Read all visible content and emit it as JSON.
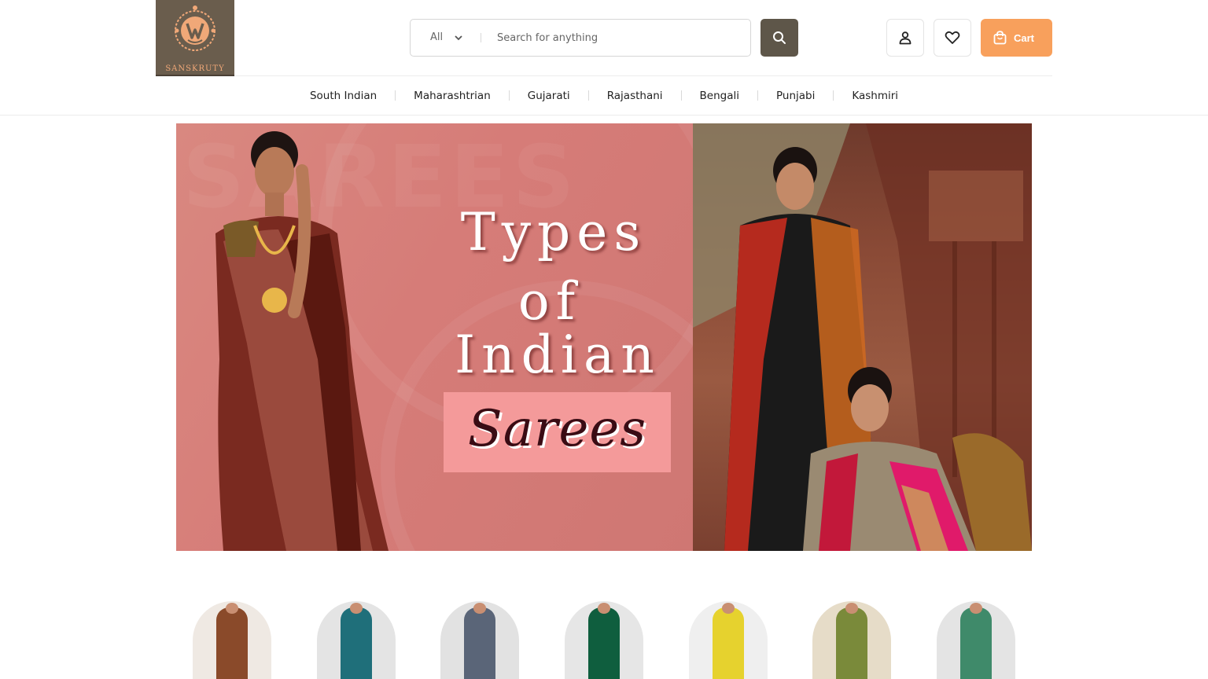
{
  "brand": {
    "name": "SANSKRUTY",
    "logo_bg": "#6a5d4d",
    "logo_accent": "#f0a878"
  },
  "search": {
    "category": "All",
    "placeholder": "Search for anything"
  },
  "header": {
    "cart_label": "Cart",
    "accent": "#f8a05c",
    "search_button_bg": "#5e5649"
  },
  "nav": {
    "items": [
      "South Indian",
      "Maharashtrian",
      "Gujarati",
      "Rajasthani",
      "Bengali",
      "Punjabi",
      "Kashmiri"
    ]
  },
  "hero": {
    "watermark": "SAREES",
    "line1": "Types",
    "line2": "of",
    "line3": "Indian",
    "line4": "Sarees"
  },
  "products": [
    {
      "color": "#8a4a2a",
      "bg": "#efe9e3"
    },
    {
      "color": "#1f6f7a",
      "bg": "#e4e4e4"
    },
    {
      "color": "#5a6578",
      "bg": "#e2e2e2"
    },
    {
      "color": "#0f5e3e",
      "bg": "#e6e6e6"
    },
    {
      "color": "#e6d22e",
      "bg": "#efefef"
    },
    {
      "color": "#7a8a3a",
      "bg": "#e6dcc8"
    },
    {
      "color": "#3f8a6a",
      "bg": "#e4e4e4"
    }
  ]
}
